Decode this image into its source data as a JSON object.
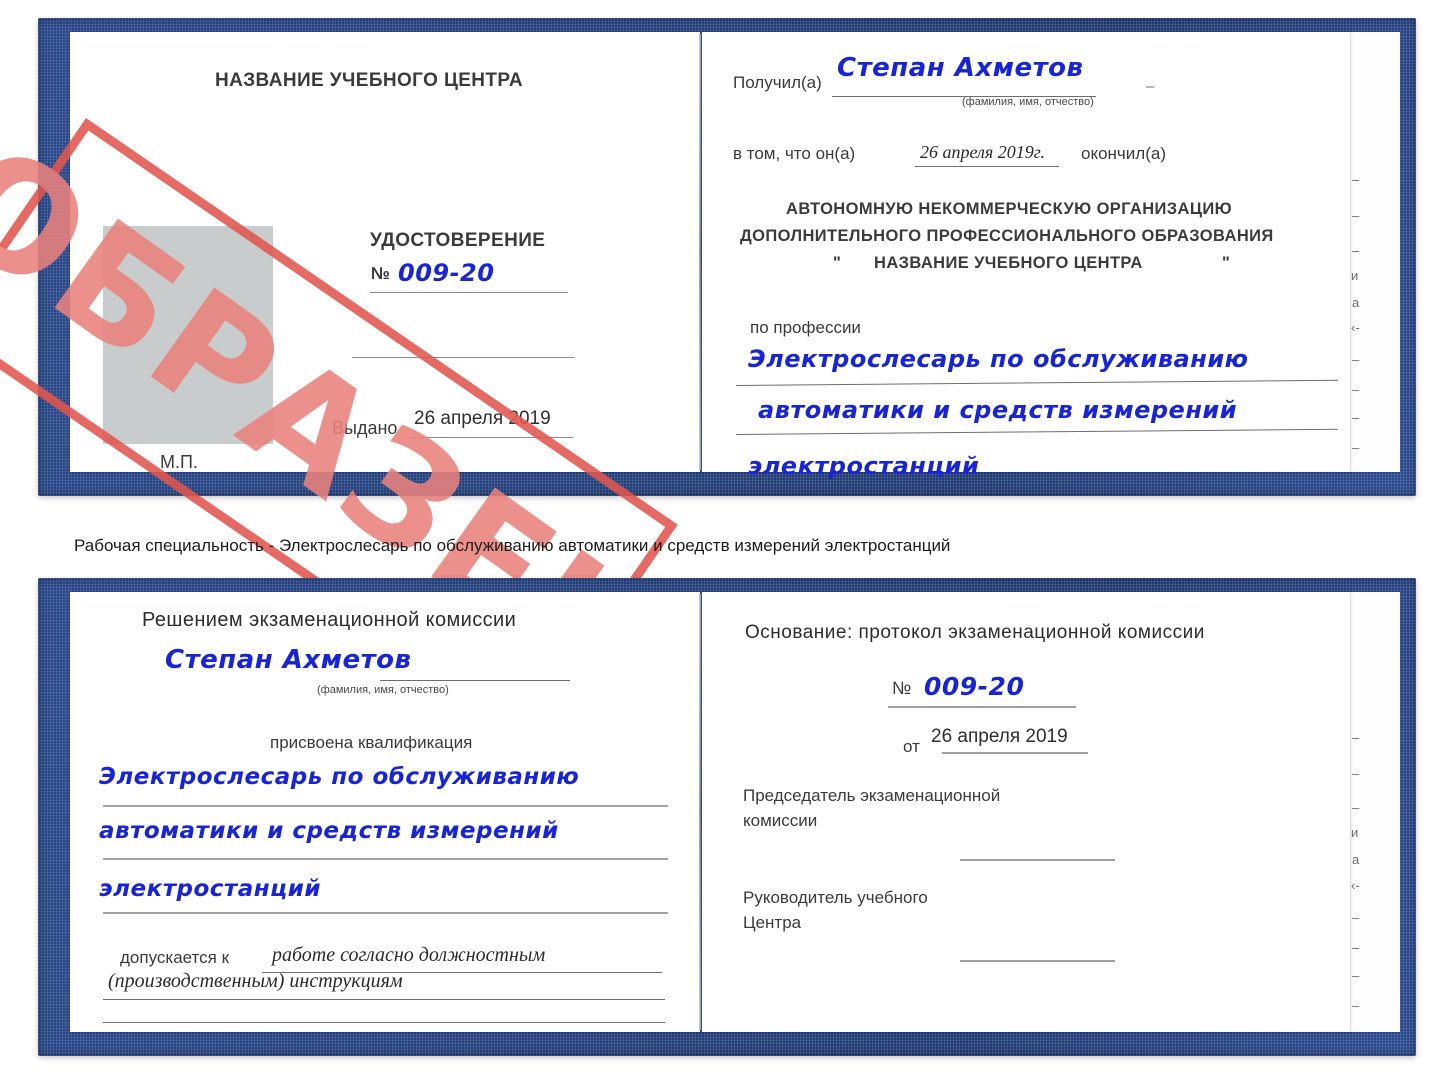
{
  "caption": {
    "text": "Рабочая специальность - Электрослесарь по обслуживанию автоматики и средств измерений электростанций"
  },
  "colors": {
    "cover_blue": "#24427f",
    "stamp_red": "#e2564f",
    "ink_blue": "#1724d8",
    "photo_gray": "#c9cccd"
  },
  "stamp": {
    "label": "ОБРАЗЕЦ"
  },
  "certificate_top": {
    "left_page": {
      "center_title": "НАЗВАНИЕ УЧЕБНОГО ЦЕНТРА",
      "doc_type": "УДОСТОВЕРЕНИЕ",
      "number_prefix": "№",
      "number_value": "009-20",
      "issued_label": "Выдано",
      "issued_value": "26 апреля 2019",
      "seal_label": "М.П."
    },
    "right_page": {
      "received_label": "Получил(а)",
      "received_value": "Степан Ахметов",
      "fio_hint": "(фамилия, имя, отчество)",
      "that_he_label": "в том, что он(а)",
      "finished_date": "26 апреля 2019г.",
      "finished_label": "окончил(а)",
      "org_line1": "АВТОНОМНУЮ НЕКОММЕРЧЕСКУЮ ОРГАНИЗАЦИЮ",
      "org_line2": "ДОПОЛНИТЕЛЬНОГО ПРОФЕССИОНАЛЬНОГО ОБРАЗОВАНИЯ",
      "org_quote_open": "\"",
      "org_line3": "НАЗВАНИЕ УЧЕБНОГО ЦЕНТРА",
      "org_quote_close": "\"",
      "profession_label": "по профессии",
      "profession_line1": "Электрослесарь по обслуживанию",
      "profession_line2": "автоматики и средств измерений",
      "profession_line3": "электростанций",
      "edge_fragments": [
        "–",
        "–",
        "–",
        "и",
        "а",
        "‹-",
        "–",
        "–",
        "–",
        "–"
      ]
    }
  },
  "certificate_bottom": {
    "left_page": {
      "heading": "Решением экзаменационной комиссии",
      "name_value": "Степан Ахметов",
      "fio_hint": "(фамилия, имя, отчество)",
      "qualification_label": "присвоена квалификация",
      "qualification_line1": "Электрослесарь по обслуживанию",
      "qualification_line2": "автоматики и средств измерений",
      "qualification_line3": "электростанций",
      "admitted_label": "допускается к",
      "admitted_value_line1": "работе согласно должностным",
      "admitted_value_line2": "(производственным) инструкциям"
    },
    "right_page": {
      "basis_label": "Основание: протокол экзаменационной комиссии",
      "number_prefix": "№",
      "number_value": "009-20",
      "date_prefix": "от",
      "date_value": "26 апреля 2019",
      "chairman_line1": "Председатель экзаменационной",
      "chairman_line2": "комиссии",
      "head_line1": "Руководитель учебного",
      "head_line2": "Центра",
      "edge_fragments": [
        "–",
        "–",
        "–",
        "и",
        "а",
        "‹-",
        "–",
        "–",
        "–",
        "–"
      ]
    }
  }
}
